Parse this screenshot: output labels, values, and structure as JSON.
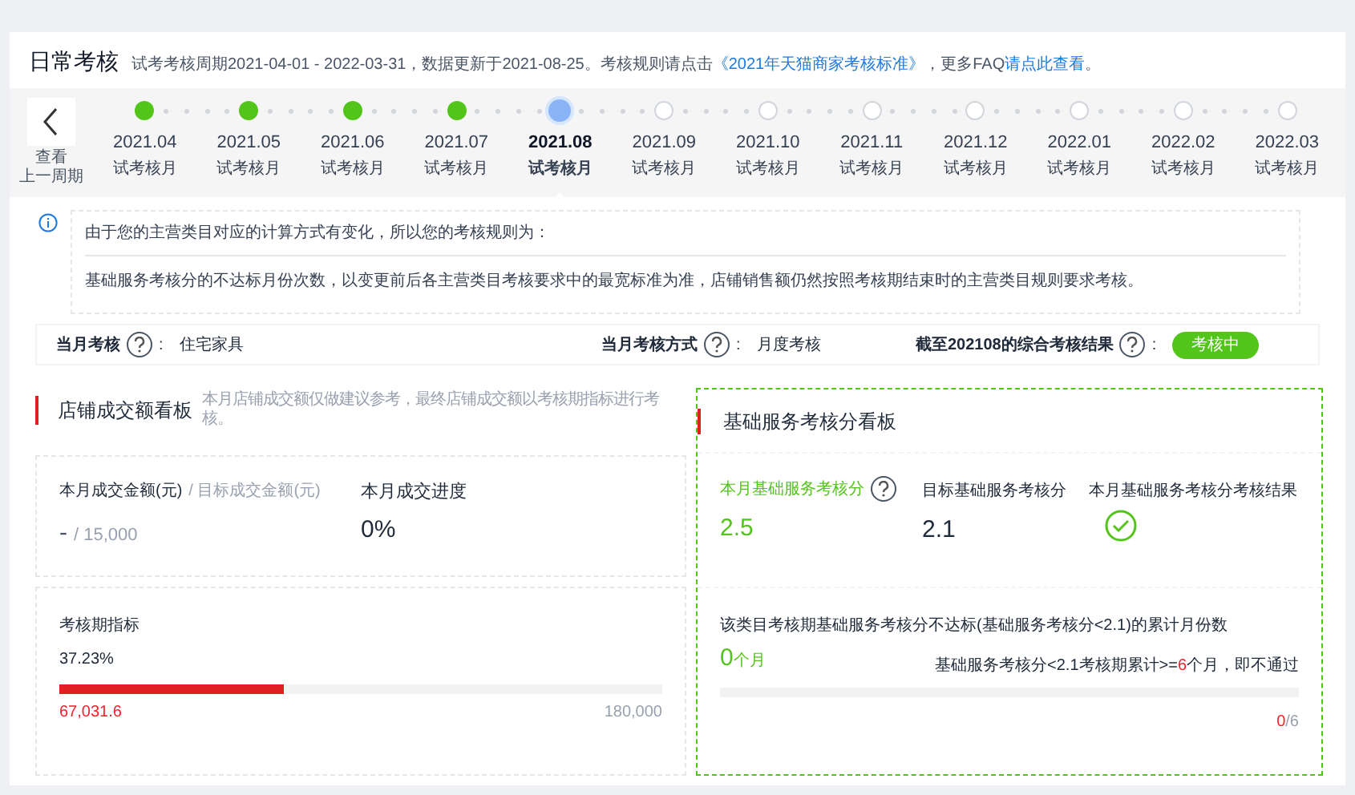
{
  "header": {
    "title": "日常考核",
    "desc_prefix": "试考考核周期2021-04-01 - 2022-03-31，数据更新于2021-08-25。考核规则请点击",
    "rule_link": "《2021年天猫商家考核标准》",
    "desc_mid": "，更多FAQ",
    "faq_link": "请点此查看",
    "desc_end": "。"
  },
  "prev_button": {
    "label_1": "查看",
    "label_2": "上一周期"
  },
  "months": [
    {
      "month": "2021.04",
      "label": "试考核月",
      "kind": "done",
      "selected": false
    },
    {
      "month": "2021.05",
      "label": "试考核月",
      "kind": "done",
      "selected": false
    },
    {
      "month": "2021.06",
      "label": "试考核月",
      "kind": "done",
      "selected": false
    },
    {
      "month": "2021.07",
      "label": "试考核月",
      "kind": "done",
      "selected": false
    },
    {
      "month": "2021.08",
      "label": "试考核月",
      "kind": "current",
      "selected": true
    },
    {
      "month": "2021.09",
      "label": "试考核月",
      "kind": "upcoming",
      "selected": false
    },
    {
      "month": "2021.10",
      "label": "试考核月",
      "kind": "upcoming",
      "selected": false
    },
    {
      "month": "2021.11",
      "label": "试考核月",
      "kind": "upcoming",
      "selected": false
    },
    {
      "month": "2021.12",
      "label": "试考核月",
      "kind": "upcoming",
      "selected": false
    },
    {
      "month": "2022.01",
      "label": "试考核月",
      "kind": "upcoming",
      "selected": false
    },
    {
      "month": "2022.02",
      "label": "试考核月",
      "kind": "upcoming",
      "selected": false
    },
    {
      "month": "2022.03",
      "label": "试考核月",
      "kind": "upcoming",
      "selected": false
    }
  ],
  "notice": {
    "line_1": "由于您的主营类目对应的计算方式有变化，所以您的考核规则为：",
    "line_2": "基础服务考核分的不达标月份次数，以变更前后各主营类目考核要求中的最宽标准为准，店铺销售额仍然按照考核期结束时的主营类目规则要求考核。"
  },
  "info_row": [
    {
      "label": "当月考核",
      "colon": ":",
      "value": "住宅家具",
      "kind": "text"
    },
    {
      "label": "当月考核方式",
      "colon": ":",
      "value": "月度考核",
      "kind": "text"
    },
    {
      "label": "截至202108的综合考核结果",
      "colon": ":",
      "value": "考核中",
      "kind": "badge"
    }
  ],
  "sales_panel": {
    "title": "店铺成交额看板",
    "subtitle": "本月店铺成交额仅做建议参考，最终店铺成交额以考核期指标进行考核。",
    "amount_label": "本月成交金额(元)",
    "target_label": "/ 目标成交金额(元)",
    "amount": "-",
    "target": "/ 15,000",
    "progress_label": "本月成交进度",
    "progress": "0%",
    "period_label": "考核期指标",
    "period_percent": "37.23%",
    "level": 0.3723,
    "period_value": "67,031.6",
    "period_target": "180,000"
  },
  "service_panel": {
    "title": "基础服务考核分看板",
    "score_label": "本月基础服务考核分",
    "score": "2.5",
    "target_label": "目标基础服务考核分",
    "target": "2.1",
    "result_label": "本月基础服务考核分考核结果",
    "passed": true,
    "count_label": "该类目考核期基础服务考核分不达标(基础服务考核分<2.1)的累计月份数",
    "count": "0",
    "count_unit": "个月",
    "rule_before": "基础服务考核分<2.1考核期累计>=",
    "rule_count": "6",
    "rule_after": "个月，即不通过",
    "ratio_value": "0",
    "ratio_total": "/6"
  }
}
